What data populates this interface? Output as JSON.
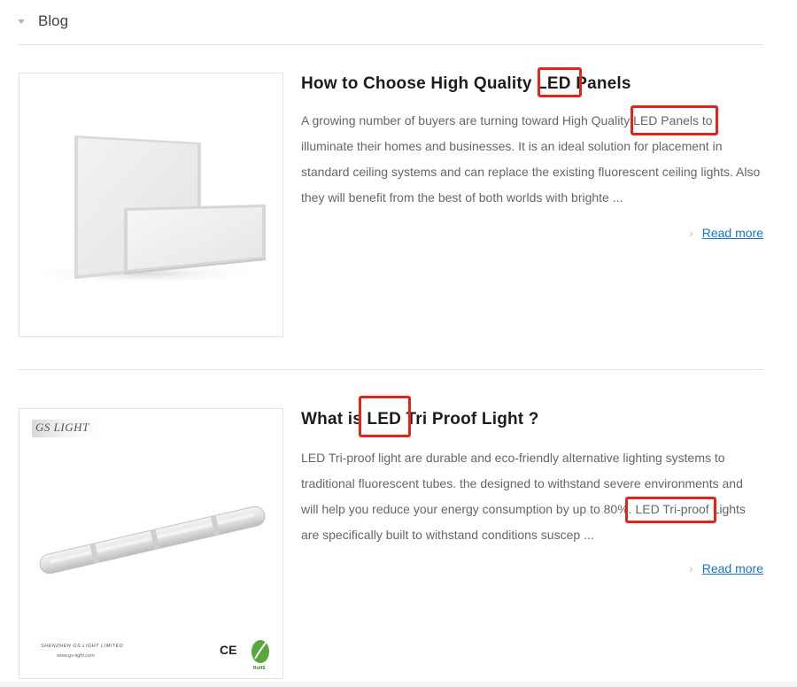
{
  "header": {
    "title": "Blog"
  },
  "posts": [
    {
      "title": "How to Choose High Quality LED Panels",
      "excerpt": "A growing number of buyers are turning toward High Quality LED Panels to illuminate their homes and businesses. It is an ideal solution for placement in standard ceiling systems and can replace the existing fluorescent ceiling lights. Also they will benefit from the best of both worlds with brighte ...",
      "read_more": "Read more",
      "image": {
        "icon": "led-panel-image"
      }
    },
    {
      "title": "What is LED Tri Proof Light ?",
      "excerpt": "LED Tri-proof light are durable and eco-friendly alternative lighting systems to traditional fluorescent tubes. the designed to withstand severe environments and will help you reduce your energy consumption by up to 80%. LED Tri-proof Lights are specifically built to withstand conditions suscep ...",
      "read_more": "Read more",
      "image": {
        "icon": "tri-proof-light-image",
        "logo": "GS LIGHT",
        "company": "SHENZHEN GS LIGHT LIMITED",
        "website": "www.gs-light.com",
        "ce_mark": "CE",
        "rohs_mark": "RoHS"
      }
    }
  ],
  "colors": {
    "highlight": "#e4231a",
    "link": "#1a73c8",
    "divider": "#e3e3e3"
  }
}
